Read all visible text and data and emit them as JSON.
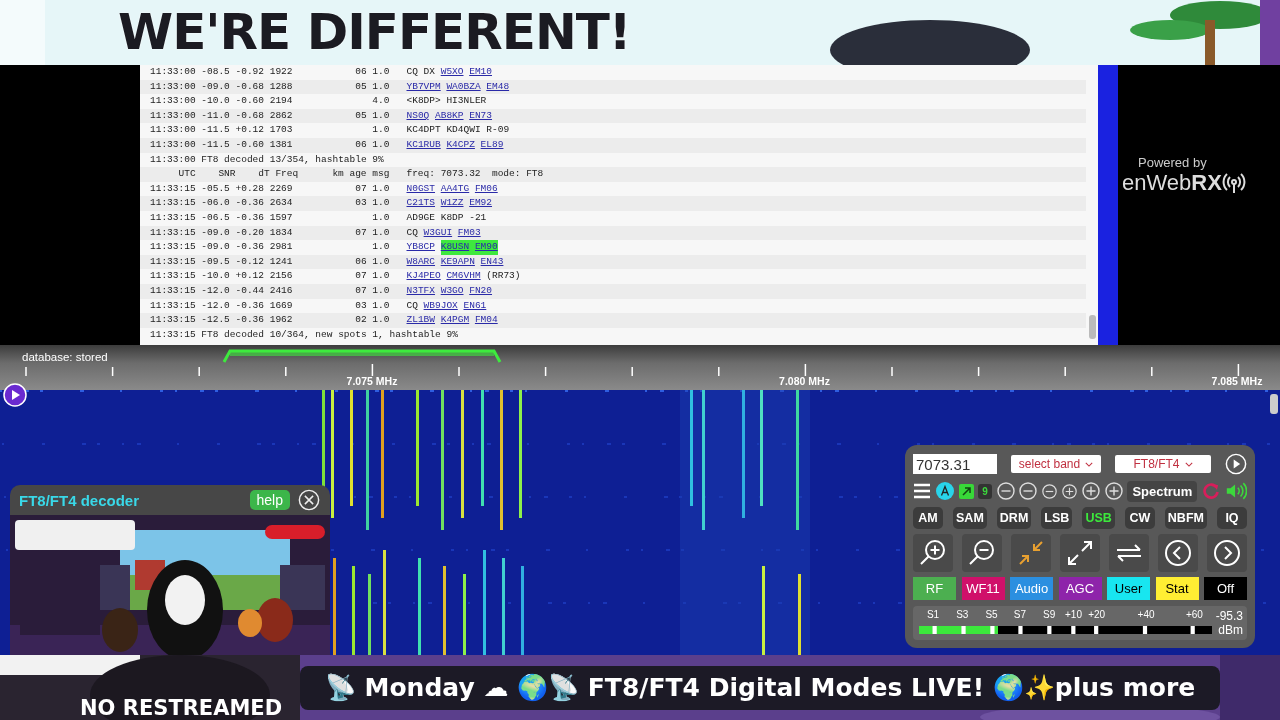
{
  "banner": {
    "headline": "WE'RE DIFFERENT!"
  },
  "log": {
    "rows": [
      {
        "kind": "decode",
        "utc": "11:33:00",
        "snr": "-08.5",
        "dt": "-0.92",
        "freq": "1922",
        "km": "06",
        "age": "1.0",
        "msg": [
          {
            "text": "CQ",
            "link": false,
            "highlighted": false
          },
          {
            "text": "DX",
            "link": false,
            "highlighted": false
          },
          {
            "text": "W5XO",
            "link": true,
            "highlighted": false
          },
          {
            "text": "EM10",
            "link": true,
            "highlighted": false
          }
        ]
      },
      {
        "kind": "decode",
        "utc": "11:33:00",
        "snr": "-09.0",
        "dt": "-0.68",
        "freq": "1288",
        "km": "05",
        "age": "1.0",
        "msg": [
          {
            "text": "YB7VPM",
            "link": true,
            "highlighted": false
          },
          {
            "text": "WA0BZA",
            "link": true,
            "highlighted": false
          },
          {
            "text": "EM48",
            "link": true,
            "highlighted": false
          }
        ]
      },
      {
        "kind": "decode",
        "utc": "11:33:00",
        "snr": "-10.0",
        "dt": "-0.60",
        "freq": "2194",
        "age": "4.0",
        "msg": [
          {
            "text": "<K8DP>",
            "link": false,
            "highlighted": false
          },
          {
            "text": "HI3NLER",
            "link": false,
            "highlighted": false
          }
        ]
      },
      {
        "kind": "decode",
        "utc": "11:33:00",
        "snr": "-11.0",
        "dt": "-0.68",
        "freq": "2862",
        "km": "05",
        "age": "1.0",
        "msg": [
          {
            "text": "NS0Q",
            "link": true,
            "highlighted": false
          },
          {
            "text": "AB8KP",
            "link": true,
            "highlighted": false
          },
          {
            "text": "EN73",
            "link": true,
            "highlighted": false
          }
        ]
      },
      {
        "kind": "decode",
        "utc": "11:33:00",
        "snr": "-11.5",
        "dt": "+0.12",
        "freq": "1703",
        "age": "1.0",
        "msg": [
          {
            "text": "KC4DPT",
            "link": false,
            "highlighted": false
          },
          {
            "text": "KD4QWI",
            "link": false,
            "highlighted": false
          },
          {
            "text": "R-09",
            "link": false,
            "highlighted": false
          }
        ]
      },
      {
        "kind": "decode",
        "utc": "11:33:00",
        "snr": "-11.5",
        "dt": "-0.60",
        "freq": "1381",
        "km": "06",
        "age": "1.0",
        "msg": [
          {
            "text": "KC1RUB",
            "link": true,
            "highlighted": false
          },
          {
            "text": "K4CPZ",
            "link": true,
            "highlighted": false
          },
          {
            "text": "EL89",
            "link": true,
            "highlighted": false
          }
        ]
      },
      {
        "kind": "summary",
        "text": "11:33:00 FT8 decoded 13/354, hashtable 9%"
      },
      {
        "kind": "header",
        "columns": [
          "UTC",
          "SNR",
          "dT",
          "Freq",
          "km",
          "age",
          "msg"
        ],
        "info": "freq: 7073.32  mode: FT8"
      },
      {
        "kind": "decode",
        "utc": "11:33:15",
        "snr": "-05.5",
        "dt": "+0.28",
        "freq": "2269",
        "km": "07",
        "age": "1.0",
        "msg": [
          {
            "text": "N0GST",
            "link": true,
            "highlighted": false
          },
          {
            "text": "AA4TG",
            "link": true,
            "highlighted": false
          },
          {
            "text": "FM06",
            "link": true,
            "highlighted": false
          }
        ]
      },
      {
        "kind": "decode",
        "utc": "11:33:15",
        "snr": "-06.0",
        "dt": "-0.36",
        "freq": "2634",
        "km": "03",
        "age": "1.0",
        "msg": [
          {
            "text": "C21TS",
            "link": true,
            "highlighted": false
          },
          {
            "text": "W1ZZ",
            "link": true,
            "highlighted": false
          },
          {
            "text": "EM92",
            "link": true,
            "highlighted": false
          }
        ]
      },
      {
        "kind": "decode",
        "utc": "11:33:15",
        "snr": "-06.5",
        "dt": "-0.36",
        "freq": "1597",
        "age": "1.0",
        "msg": [
          {
            "text": "AD9GE",
            "link": false,
            "highlighted": false
          },
          {
            "text": "K8DP",
            "link": false,
            "highlighted": false
          },
          {
            "text": "-21",
            "link": false,
            "highlighted": false
          }
        ]
      },
      {
        "kind": "decode",
        "utc": "11:33:15",
        "snr": "-09.0",
        "dt": "-0.20",
        "freq": "1834",
        "km": "07",
        "age": "1.0",
        "msg": [
          {
            "text": "CQ",
            "link": false,
            "highlighted": false
          },
          {
            "text": "W3GUI",
            "link": true,
            "highlighted": false
          },
          {
            "text": "FM03",
            "link": true,
            "highlighted": false
          }
        ]
      },
      {
        "kind": "decode",
        "utc": "11:33:15",
        "snr": "-09.0",
        "dt": "-0.36",
        "freq": "2981",
        "age": "1.0",
        "msg": [
          {
            "text": "YB8CP",
            "link": true,
            "highlighted": false
          },
          {
            "text": "K8USN",
            "link": true,
            "highlighted": true
          },
          {
            "text": "EM90",
            "link": true,
            "highlighted": true
          }
        ]
      },
      {
        "kind": "decode",
        "utc": "11:33:15",
        "snr": "-09.5",
        "dt": "-0.12",
        "freq": "1241",
        "km": "06",
        "age": "1.0",
        "msg": [
          {
            "text": "W8ARC",
            "link": true,
            "highlighted": false
          },
          {
            "text": "KE9APN",
            "link": true,
            "highlighted": false
          },
          {
            "text": "EN43",
            "link": true,
            "highlighted": false
          }
        ]
      },
      {
        "kind": "decode",
        "utc": "11:33:15",
        "snr": "-10.0",
        "dt": "+0.12",
        "freq": "2156",
        "km": "07",
        "age": "1.0",
        "msg": [
          {
            "text": "KJ4PEO",
            "link": true,
            "highlighted": false
          },
          {
            "text": "CM6VHM",
            "link": true,
            "highlighted": false
          },
          {
            "text": "(RR73)",
            "link": false,
            "highlighted": false
          }
        ]
      },
      {
        "kind": "decode",
        "utc": "11:33:15",
        "snr": "-12.0",
        "dt": "-0.44",
        "freq": "2416",
        "km": "07",
        "age": "1.0",
        "msg": [
          {
            "text": "N3TFX",
            "link": true,
            "highlighted": false
          },
          {
            "text": "W3GO",
            "link": true,
            "highlighted": false
          },
          {
            "text": "FN20",
            "link": true,
            "highlighted": false
          }
        ]
      },
      {
        "kind": "decode",
        "utc": "11:33:15",
        "snr": "-12.0",
        "dt": "-0.36",
        "freq": "1669",
        "km": "03",
        "age": "1.0",
        "msg": [
          {
            "text": "CQ",
            "link": false,
            "highlighted": false
          },
          {
            "text": "WB9JOX",
            "link": true,
            "highlighted": false
          },
          {
            "text": "EN61",
            "link": true,
            "highlighted": false
          }
        ]
      },
      {
        "kind": "decode",
        "utc": "11:33:15",
        "snr": "-12.5",
        "dt": "-0.36",
        "freq": "1962",
        "km": "02",
        "age": "1.0",
        "msg": [
          {
            "text": "ZL1BW",
            "link": true,
            "highlighted": false
          },
          {
            "text": "K4PGM",
            "link": true,
            "highlighted": false
          },
          {
            "text": "FM04",
            "link": true,
            "highlighted": false
          }
        ]
      },
      {
        "kind": "summary",
        "text": "11:33:15 FT8 decoded 10/364, new spots 1, hashtable 9%"
      }
    ]
  },
  "logo": {
    "caption": "Powered by",
    "name": "enWeb**RX**"
  },
  "scale": {
    "status": "database: stored",
    "labels": [
      "7.075 MHz",
      "7.080 MHz",
      "7.085 MHz"
    ]
  },
  "decoder": {
    "title": "FT8/FT4 decoder",
    "help": "help"
  },
  "receiver": {
    "frequency": "7073.31",
    "band": "select band",
    "preset": "FT8/FT4",
    "badge": "9",
    "spectrum": "Spectrum",
    "modes": [
      {
        "label": "AM",
        "selected": false
      },
      {
        "label": "SAM",
        "selected": false
      },
      {
        "label": "DRM",
        "selected": false
      },
      {
        "label": "LSB",
        "selected": false
      },
      {
        "label": "USB",
        "selected": true
      },
      {
        "label": "CW",
        "selected": false
      },
      {
        "label": "NBFM",
        "selected": false
      },
      {
        "label": "IQ",
        "selected": false
      }
    ],
    "panels": [
      {
        "label": "RF",
        "color": "#4caf50"
      },
      {
        "label": "WF11",
        "color": "#d0106a"
      },
      {
        "label": "Audio",
        "color": "#2b8fe0"
      },
      {
        "label": "AGC",
        "color": "#8e24aa"
      },
      {
        "label": "User",
        "color": "#18e6f0"
      },
      {
        "label": "Stat",
        "color": "#ffee33"
      },
      {
        "label": "Off",
        "color": "#000000"
      }
    ],
    "smeter": {
      "scale": [
        "S1",
        "S3",
        "S5",
        "S7",
        "S9",
        "+10",
        "+20",
        "+40",
        "+60"
      ],
      "reading": "-95.3",
      "unit": "dBm",
      "level": 0.27
    }
  },
  "overlay": {
    "caption": "NO RESTREAMED",
    "ticker": "📡 Monday ☁ 🌍📡 FT8/FT4 Digital Modes LIVE! 🌍✨plus more"
  }
}
